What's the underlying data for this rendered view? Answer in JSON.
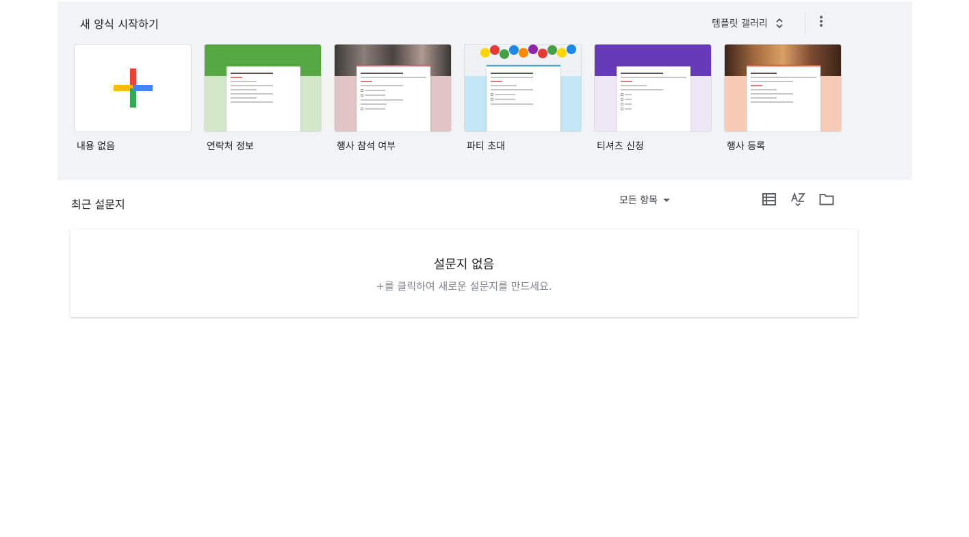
{
  "gallery": {
    "title": "새 양식 시작하기",
    "toggle_label": "템플릿 갤러리",
    "more_icon": "more-vert-icon",
    "templates": [
      {
        "label": "내용 없음",
        "kind": "blank"
      },
      {
        "label": "연락처 정보",
        "kind": "form",
        "banner_color": "#56a845",
        "body_color": "#d2e8c9",
        "accent": "#56a845"
      },
      {
        "label": "행사 참석 여부",
        "kind": "form",
        "banner_color": "#5f5a55",
        "body_color": "#e3c4c6",
        "accent": "#d96570"
      },
      {
        "label": "파티 초대",
        "kind": "form",
        "banner_color": "#e9eef2",
        "body_color": "#c3e6f6",
        "accent": "#3aa5d7"
      },
      {
        "label": "티셔츠 신청",
        "kind": "form",
        "banner_color": "#673ab7",
        "body_color": "#ede7f6",
        "accent": "#673ab7"
      },
      {
        "label": "행사 등록",
        "kind": "form",
        "banner_color": "#7a4a30",
        "body_color": "#f8cbb6",
        "accent": "#e0643c"
      }
    ]
  },
  "recent": {
    "title": "최근 설문지",
    "filter_label": "모든 항목",
    "icons": [
      "list-view-icon",
      "sort-az-icon",
      "folder-icon"
    ],
    "empty_title": "설문지 없음",
    "empty_subtitle": "+를 클릭하여 새로운 설문지를 만드세요."
  },
  "colors": {
    "plus_red": "#ea4335",
    "plus_blue": "#4285f4",
    "plus_green": "#34a853",
    "plus_yellow": "#fbbc04"
  }
}
